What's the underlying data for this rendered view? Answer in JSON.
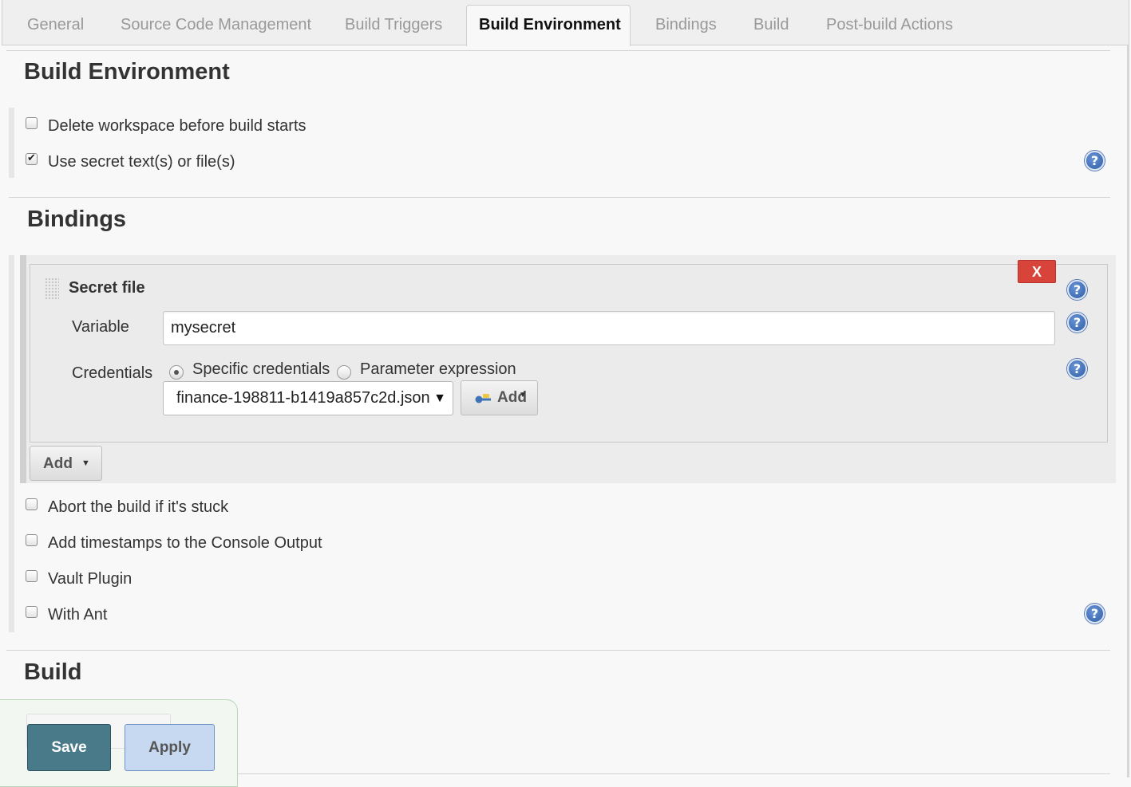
{
  "tabs": [
    {
      "label": "General",
      "active": false
    },
    {
      "label": "Source Code Management",
      "active": false
    },
    {
      "label": "Build Triggers",
      "active": false
    },
    {
      "label": "Build Environment",
      "active": true
    },
    {
      "label": "Bindings",
      "active": false
    },
    {
      "label": "Build",
      "active": false
    },
    {
      "label": "Post-build Actions",
      "active": false
    }
  ],
  "build_environment": {
    "title": "Build Environment",
    "options": [
      {
        "label": "Delete workspace before build starts",
        "checked": false
      },
      {
        "label": "Use secret text(s) or file(s)",
        "checked": true
      }
    ]
  },
  "bindings": {
    "title": "Bindings",
    "secret_file": {
      "title": "Secret file",
      "delete_label": "X",
      "variable_label": "Variable",
      "variable_value": "mysecret",
      "credentials_label": "Credentials",
      "radio_specific": "Specific credentials",
      "radio_parameter": "Parameter expression",
      "selected_radio": "specific",
      "credential_selected": "finance-198811-b1419a857c2d.json",
      "add_credential_label": "Add"
    },
    "add_label": "Add"
  },
  "more_options": [
    {
      "label": "Abort the build if it's stuck",
      "checked": false
    },
    {
      "label": "Add timestamps to the Console Output",
      "checked": false
    },
    {
      "label": "Vault Plugin",
      "checked": false
    },
    {
      "label": "With Ant",
      "checked": false
    }
  ],
  "build": {
    "title": "Build"
  },
  "footer": {
    "save_label": "Save",
    "apply_label": "Apply"
  },
  "colors": {
    "delete_button": "#d9443a",
    "save_button": "#497a89",
    "apply_button": "#c6d9f0",
    "help_icon": "#2f5ea6"
  }
}
